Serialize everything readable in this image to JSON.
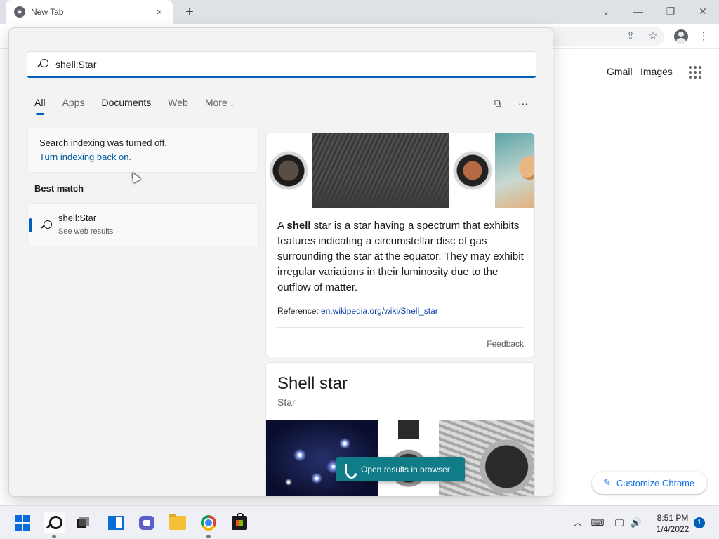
{
  "browser": {
    "tab_title": "New Tab",
    "tab_close": "×",
    "new_tab": "+",
    "window_controls": {
      "dropdown": "⌄",
      "minimize": "—",
      "restore": "❐",
      "close": "✕"
    },
    "toolbar_icons": {
      "share": "⇪",
      "bookmark": "☆",
      "menu": "⋮"
    },
    "ntp": {
      "gmail": "Gmail",
      "images": "Images",
      "customize_label": "Customize Chrome",
      "pencil": "✎"
    }
  },
  "search": {
    "query": "shell:Star",
    "filters": [
      {
        "label": "All"
      },
      {
        "label": "Apps"
      },
      {
        "label": "Documents"
      },
      {
        "label": "Web"
      },
      {
        "label": "More"
      }
    ],
    "more_chevron": "⌄",
    "panel_icons": {
      "share_ui": "⧉",
      "more": "···"
    },
    "notice": {
      "text": "Search indexing was turned off.",
      "link": "Turn indexing back on."
    },
    "best_match_label": "Best match",
    "best_match": {
      "title": "shell:Star",
      "subtitle": "See web results"
    },
    "preview": {
      "desc_prefix": "A ",
      "desc_bold": "shell",
      "desc_rest": " star is a star having a spectrum that exhibits features indicating a circumstellar disc of gas surrounding the star at the equator. They may exhibit irregular variations in their luminosity due to the outflow of matter.",
      "reference_label": "Reference: ",
      "reference_link": "en.wikipedia.org/wiki/Shell_star",
      "feedback": "Feedback",
      "entity_title": "Shell star",
      "entity_subtitle": "Star"
    },
    "open_browser_label": "Open results in browser"
  },
  "taskbar": {
    "tray": {
      "chevron": "︿",
      "keyboard": "⌨",
      "network": "🖵",
      "volume": "🔊"
    },
    "time": "8:51 PM",
    "date": "1/4/2022",
    "notifications": "1"
  },
  "colors": {
    "accent": "#005fb8",
    "bing_button": "#107c88",
    "link": "#005a9e",
    "chrome_link": "#1a73e8"
  }
}
